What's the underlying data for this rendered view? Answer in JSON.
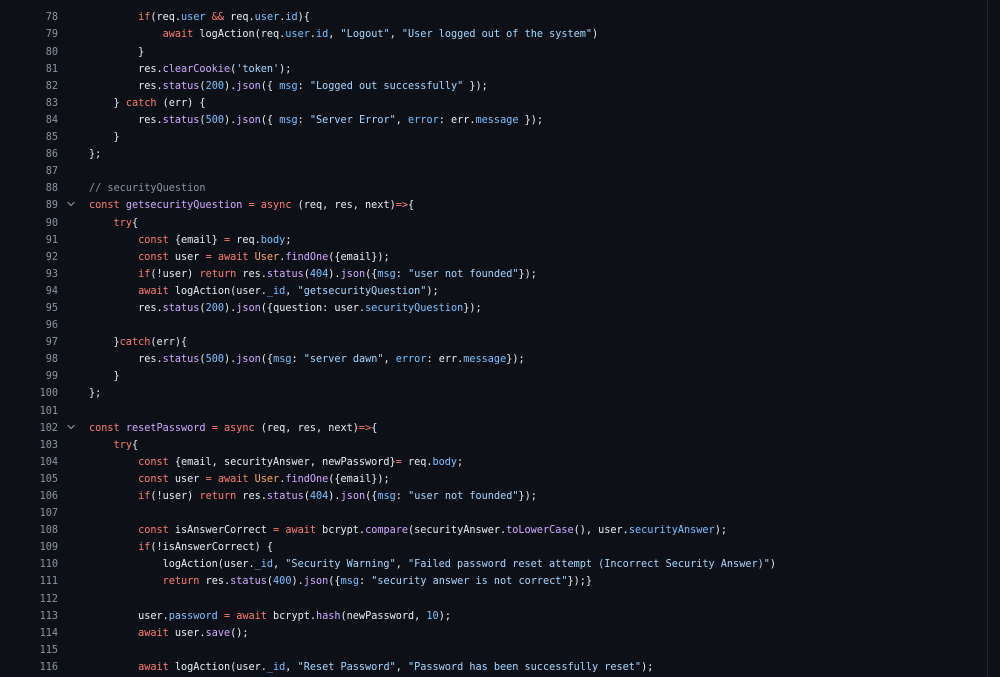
{
  "editor": {
    "colors": {
      "background": "#0d1117",
      "line_number": "#8b949e",
      "text": "#e6edf3",
      "keyword": "#ff7b72",
      "string": "#a5d6ff",
      "number": "#79c0ff",
      "function": "#d2a8ff",
      "property": "#79c0ff",
      "comment": "#8b949e",
      "type": "#ffa657"
    },
    "fold_icon": "chevron-down-icon",
    "lines": [
      {
        "n": "78",
        "fold": false,
        "tokens": [
          [
            "o",
            "        "
          ],
          [
            "k",
            "if"
          ],
          [
            "o",
            "(req."
          ],
          [
            "p",
            "user"
          ],
          [
            "o",
            " "
          ],
          [
            "k",
            "&&"
          ],
          [
            "o",
            " req."
          ],
          [
            "p",
            "user"
          ],
          [
            "o",
            "."
          ],
          [
            "p",
            "id"
          ],
          [
            "o",
            "){"
          ]
        ]
      },
      {
        "n": "79",
        "fold": false,
        "tokens": [
          [
            "o",
            "            "
          ],
          [
            "k",
            "await"
          ],
          [
            "o",
            " logAction(req."
          ],
          [
            "p",
            "user"
          ],
          [
            "o",
            "."
          ],
          [
            "p",
            "id"
          ],
          [
            "o",
            ", "
          ],
          [
            "s",
            "\"Logout\""
          ],
          [
            "o",
            ", "
          ],
          [
            "s",
            "\"User logged out of the system\""
          ],
          [
            "o",
            ")"
          ]
        ]
      },
      {
        "n": "80",
        "fold": false,
        "tokens": [
          [
            "o",
            "        }"
          ]
        ]
      },
      {
        "n": "81",
        "fold": false,
        "tokens": [
          [
            "o",
            "        res."
          ],
          [
            "f",
            "clearCookie"
          ],
          [
            "o",
            "("
          ],
          [
            "s",
            "'token'"
          ],
          [
            "o",
            ");"
          ]
        ]
      },
      {
        "n": "82",
        "fold": false,
        "tokens": [
          [
            "o",
            "        res."
          ],
          [
            "f",
            "status"
          ],
          [
            "o",
            "("
          ],
          [
            "n",
            "200"
          ],
          [
            "o",
            ")."
          ],
          [
            "f",
            "json"
          ],
          [
            "o",
            "({ "
          ],
          [
            "p",
            "msg"
          ],
          [
            "o",
            ": "
          ],
          [
            "s",
            "\"Logged out successfully\""
          ],
          [
            "o",
            " });"
          ]
        ]
      },
      {
        "n": "83",
        "fold": false,
        "tokens": [
          [
            "o",
            "    } "
          ],
          [
            "k",
            "catch"
          ],
          [
            "o",
            " (err) {"
          ]
        ]
      },
      {
        "n": "84",
        "fold": false,
        "tokens": [
          [
            "o",
            "        res."
          ],
          [
            "f",
            "status"
          ],
          [
            "o",
            "("
          ],
          [
            "n",
            "500"
          ],
          [
            "o",
            ")."
          ],
          [
            "f",
            "json"
          ],
          [
            "o",
            "({ "
          ],
          [
            "p",
            "msg"
          ],
          [
            "o",
            ": "
          ],
          [
            "s",
            "\"Server Error\""
          ],
          [
            "o",
            ", "
          ],
          [
            "p",
            "error"
          ],
          [
            "o",
            ": err."
          ],
          [
            "p",
            "message"
          ],
          [
            "o",
            " });"
          ]
        ]
      },
      {
        "n": "85",
        "fold": false,
        "tokens": [
          [
            "o",
            "    }"
          ]
        ]
      },
      {
        "n": "86",
        "fold": false,
        "tokens": [
          [
            "o",
            "};"
          ]
        ]
      },
      {
        "n": "87",
        "fold": false,
        "tokens": []
      },
      {
        "n": "88",
        "fold": false,
        "tokens": [
          [
            "c",
            "// securityQuestion"
          ]
        ]
      },
      {
        "n": "89",
        "fold": true,
        "tokens": [
          [
            "k",
            "const"
          ],
          [
            "o",
            " "
          ],
          [
            "f",
            "getsecurityQuestion"
          ],
          [
            "o",
            " "
          ],
          [
            "k",
            "="
          ],
          [
            "o",
            " "
          ],
          [
            "k",
            "async"
          ],
          [
            "o",
            " (req, res, next)"
          ],
          [
            "k",
            "=>"
          ],
          [
            "o",
            "{"
          ]
        ]
      },
      {
        "n": "90",
        "fold": false,
        "tokens": [
          [
            "o",
            "    "
          ],
          [
            "k",
            "try"
          ],
          [
            "o",
            "{"
          ]
        ]
      },
      {
        "n": "91",
        "fold": false,
        "tokens": [
          [
            "o",
            "        "
          ],
          [
            "k",
            "const"
          ],
          [
            "o",
            " {email} "
          ],
          [
            "k",
            "="
          ],
          [
            "o",
            " req."
          ],
          [
            "p",
            "body"
          ],
          [
            "o",
            ";"
          ]
        ]
      },
      {
        "n": "92",
        "fold": false,
        "tokens": [
          [
            "o",
            "        "
          ],
          [
            "k",
            "const"
          ],
          [
            "o",
            " user "
          ],
          [
            "k",
            "="
          ],
          [
            "o",
            " "
          ],
          [
            "k",
            "await"
          ],
          [
            "o",
            " "
          ],
          [
            "t",
            "User"
          ],
          [
            "o",
            "."
          ],
          [
            "f",
            "findOne"
          ],
          [
            "o",
            "({email});"
          ]
        ]
      },
      {
        "n": "93",
        "fold": false,
        "tokens": [
          [
            "o",
            "        "
          ],
          [
            "k",
            "if"
          ],
          [
            "o",
            "(!user) "
          ],
          [
            "k",
            "return"
          ],
          [
            "o",
            " res."
          ],
          [
            "f",
            "status"
          ],
          [
            "o",
            "("
          ],
          [
            "n",
            "404"
          ],
          [
            "o",
            ")."
          ],
          [
            "f",
            "json"
          ],
          [
            "o",
            "({"
          ],
          [
            "p",
            "msg"
          ],
          [
            "o",
            ": "
          ],
          [
            "s",
            "\"user not founded\""
          ],
          [
            "o",
            "});"
          ]
        ]
      },
      {
        "n": "94",
        "fold": false,
        "tokens": [
          [
            "o",
            "        "
          ],
          [
            "k",
            "await"
          ],
          [
            "o",
            " logAction(user."
          ],
          [
            "p",
            "_id"
          ],
          [
            "o",
            ", "
          ],
          [
            "s",
            "\"getsecurityQuestion\""
          ],
          [
            "o",
            ");"
          ]
        ]
      },
      {
        "n": "95",
        "fold": false,
        "tokens": [
          [
            "o",
            "        res."
          ],
          [
            "f",
            "status"
          ],
          [
            "o",
            "("
          ],
          [
            "n",
            "200"
          ],
          [
            "o",
            ")."
          ],
          [
            "f",
            "json"
          ],
          [
            "o",
            "({question: user."
          ],
          [
            "p",
            "securityQuestion"
          ],
          [
            "o",
            "});"
          ]
        ]
      },
      {
        "n": "96",
        "fold": false,
        "tokens": []
      },
      {
        "n": "97",
        "fold": false,
        "tokens": [
          [
            "o",
            "    }"
          ],
          [
            "k",
            "catch"
          ],
          [
            "o",
            "(err){"
          ]
        ]
      },
      {
        "n": "98",
        "fold": false,
        "tokens": [
          [
            "o",
            "        res."
          ],
          [
            "f",
            "status"
          ],
          [
            "o",
            "("
          ],
          [
            "n",
            "500"
          ],
          [
            "o",
            ")."
          ],
          [
            "f",
            "json"
          ],
          [
            "o",
            "({"
          ],
          [
            "p",
            "msg"
          ],
          [
            "o",
            ": "
          ],
          [
            "s",
            "\"server dawn\""
          ],
          [
            "o",
            ", "
          ],
          [
            "p",
            "error"
          ],
          [
            "o",
            ": err."
          ],
          [
            "p",
            "message"
          ],
          [
            "o",
            "});"
          ]
        ]
      },
      {
        "n": "99",
        "fold": false,
        "tokens": [
          [
            "o",
            "    }"
          ]
        ]
      },
      {
        "n": "100",
        "fold": false,
        "tokens": [
          [
            "o",
            "};"
          ]
        ]
      },
      {
        "n": "101",
        "fold": false,
        "tokens": []
      },
      {
        "n": "102",
        "fold": true,
        "tokens": [
          [
            "k",
            "const"
          ],
          [
            "o",
            " "
          ],
          [
            "f",
            "resetPassword"
          ],
          [
            "o",
            " "
          ],
          [
            "k",
            "="
          ],
          [
            "o",
            " "
          ],
          [
            "k",
            "async"
          ],
          [
            "o",
            " (req, res, next)"
          ],
          [
            "k",
            "=>"
          ],
          [
            "o",
            "{"
          ]
        ]
      },
      {
        "n": "103",
        "fold": false,
        "tokens": [
          [
            "o",
            "    "
          ],
          [
            "k",
            "try"
          ],
          [
            "o",
            "{"
          ]
        ]
      },
      {
        "n": "104",
        "fold": false,
        "tokens": [
          [
            "o",
            "        "
          ],
          [
            "k",
            "const"
          ],
          [
            "o",
            " {email, securityAnswer, newPassword}"
          ],
          [
            "k",
            "="
          ],
          [
            "o",
            " req."
          ],
          [
            "p",
            "body"
          ],
          [
            "o",
            ";"
          ]
        ]
      },
      {
        "n": "105",
        "fold": false,
        "tokens": [
          [
            "o",
            "        "
          ],
          [
            "k",
            "const"
          ],
          [
            "o",
            " user "
          ],
          [
            "k",
            "="
          ],
          [
            "o",
            " "
          ],
          [
            "k",
            "await"
          ],
          [
            "o",
            " "
          ],
          [
            "t",
            "User"
          ],
          [
            "o",
            "."
          ],
          [
            "f",
            "findOne"
          ],
          [
            "o",
            "({email});"
          ]
        ]
      },
      {
        "n": "106",
        "fold": false,
        "tokens": [
          [
            "o",
            "        "
          ],
          [
            "k",
            "if"
          ],
          [
            "o",
            "(!user) "
          ],
          [
            "k",
            "return"
          ],
          [
            "o",
            " res."
          ],
          [
            "f",
            "status"
          ],
          [
            "o",
            "("
          ],
          [
            "n",
            "404"
          ],
          [
            "o",
            ")."
          ],
          [
            "f",
            "json"
          ],
          [
            "o",
            "({"
          ],
          [
            "p",
            "msg"
          ],
          [
            "o",
            ": "
          ],
          [
            "s",
            "\"user not founded\""
          ],
          [
            "o",
            "});"
          ]
        ]
      },
      {
        "n": "107",
        "fold": false,
        "tokens": []
      },
      {
        "n": "108",
        "fold": false,
        "tokens": [
          [
            "o",
            "        "
          ],
          [
            "k",
            "const"
          ],
          [
            "o",
            " isAnswerCorrect "
          ],
          [
            "k",
            "="
          ],
          [
            "o",
            " "
          ],
          [
            "k",
            "await"
          ],
          [
            "o",
            " bcrypt."
          ],
          [
            "f",
            "compare"
          ],
          [
            "o",
            "(securityAnswer."
          ],
          [
            "f",
            "toLowerCase"
          ],
          [
            "o",
            "(), user."
          ],
          [
            "p",
            "securityAnswer"
          ],
          [
            "o",
            ");"
          ]
        ]
      },
      {
        "n": "109",
        "fold": false,
        "tokens": [
          [
            "o",
            "        "
          ],
          [
            "k",
            "if"
          ],
          [
            "o",
            "(!isAnswerCorrect) {"
          ]
        ]
      },
      {
        "n": "110",
        "fold": false,
        "tokens": [
          [
            "o",
            "            logAction(user."
          ],
          [
            "p",
            "_id"
          ],
          [
            "o",
            ", "
          ],
          [
            "s",
            "\"Security Warning\""
          ],
          [
            "o",
            ", "
          ],
          [
            "s",
            "\"Failed password reset attempt (Incorrect Security Answer)\""
          ],
          [
            "o",
            ")"
          ]
        ]
      },
      {
        "n": "111",
        "fold": false,
        "tokens": [
          [
            "o",
            "            "
          ],
          [
            "k",
            "return"
          ],
          [
            "o",
            " res."
          ],
          [
            "f",
            "status"
          ],
          [
            "o",
            "("
          ],
          [
            "n",
            "400"
          ],
          [
            "o",
            ")."
          ],
          [
            "f",
            "json"
          ],
          [
            "o",
            "({"
          ],
          [
            "p",
            "msg"
          ],
          [
            "o",
            ": "
          ],
          [
            "s",
            "\"security answer is not correct\""
          ],
          [
            "o",
            "});}"
          ]
        ]
      },
      {
        "n": "112",
        "fold": false,
        "tokens": []
      },
      {
        "n": "113",
        "fold": false,
        "tokens": [
          [
            "o",
            "        user."
          ],
          [
            "p",
            "password"
          ],
          [
            "o",
            " "
          ],
          [
            "k",
            "="
          ],
          [
            "o",
            " "
          ],
          [
            "k",
            "await"
          ],
          [
            "o",
            " bcrypt."
          ],
          [
            "f",
            "hash"
          ],
          [
            "o",
            "(newPassword, "
          ],
          [
            "n",
            "10"
          ],
          [
            "o",
            ");"
          ]
        ]
      },
      {
        "n": "114",
        "fold": false,
        "tokens": [
          [
            "o",
            "        "
          ],
          [
            "k",
            "await"
          ],
          [
            "o",
            " user."
          ],
          [
            "f",
            "save"
          ],
          [
            "o",
            "();"
          ]
        ]
      },
      {
        "n": "115",
        "fold": false,
        "tokens": []
      },
      {
        "n": "116",
        "fold": false,
        "tokens": [
          [
            "o",
            "        "
          ],
          [
            "k",
            "await"
          ],
          [
            "o",
            " logAction(user."
          ],
          [
            "p",
            "_id"
          ],
          [
            "o",
            ", "
          ],
          [
            "s",
            "\"Reset Password\""
          ],
          [
            "o",
            ", "
          ],
          [
            "s",
            "\"Password has been successfully reset\""
          ],
          [
            "o",
            ");"
          ]
        ]
      }
    ]
  }
}
